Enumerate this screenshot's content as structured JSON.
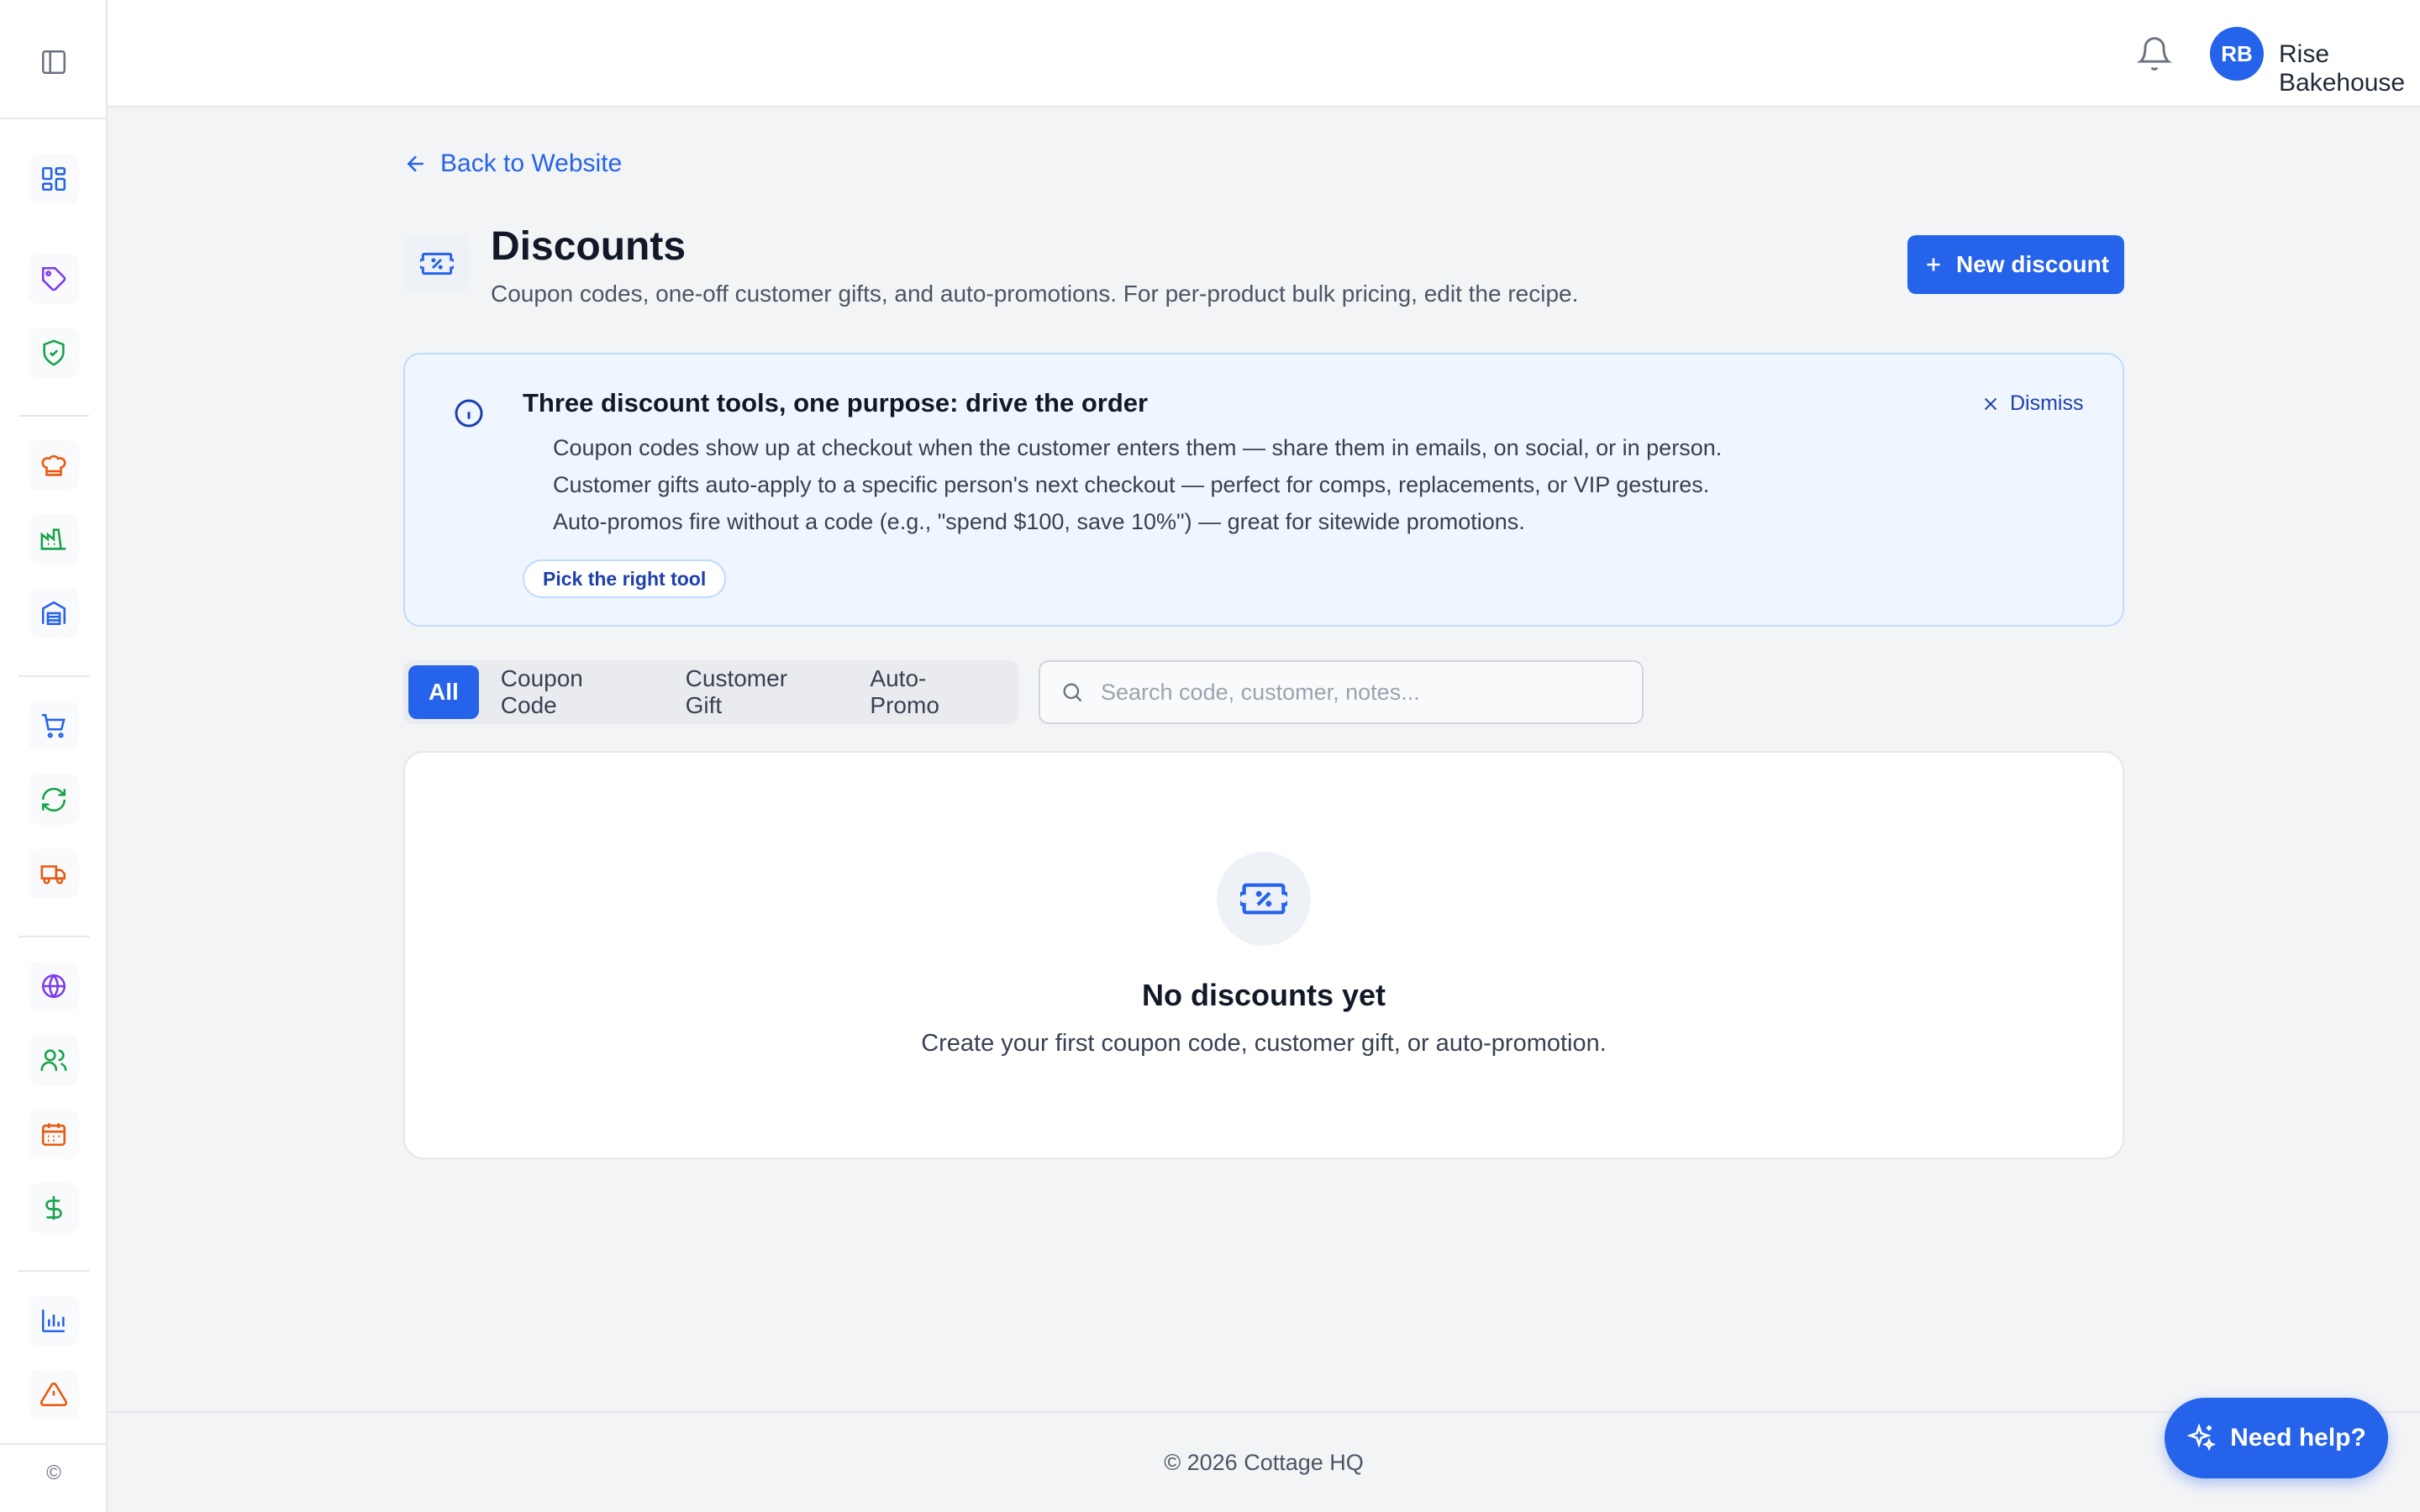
{
  "sidebar": {
    "items": [
      {
        "name": "sidebar-item-dashboard",
        "icon": "dashboard-grid-icon",
        "color": "#2563eb"
      },
      {
        "name": "sidebar-item-products",
        "icon": "tag-icon",
        "color": "#7c3aed"
      },
      {
        "name": "sidebar-item-compliance",
        "icon": "shield-check-icon",
        "color": "#16a34a"
      },
      {
        "name": "sidebar-item-recipes",
        "icon": "chef-hat-icon",
        "color": "#ea580c"
      },
      {
        "name": "sidebar-item-production",
        "icon": "factory-icon",
        "color": "#16a34a"
      },
      {
        "name": "sidebar-item-inventory",
        "icon": "warehouse-icon",
        "color": "#2563eb"
      },
      {
        "name": "sidebar-item-orders",
        "icon": "cart-icon",
        "color": "#2563eb"
      },
      {
        "name": "sidebar-item-subscriptions",
        "icon": "refresh-icon",
        "color": "#16a34a"
      },
      {
        "name": "sidebar-item-delivery",
        "icon": "truck-icon",
        "color": "#ea580c"
      },
      {
        "name": "sidebar-item-website",
        "icon": "globe-icon",
        "color": "#7c3aed"
      },
      {
        "name": "sidebar-item-customers",
        "icon": "users-icon",
        "color": "#16a34a"
      },
      {
        "name": "sidebar-item-calendar",
        "icon": "calendar-icon",
        "color": "#ea580c"
      },
      {
        "name": "sidebar-item-finance",
        "icon": "dollar-icon",
        "color": "#16a34a"
      },
      {
        "name": "sidebar-item-reports",
        "icon": "bar-chart-icon",
        "color": "#2563eb"
      },
      {
        "name": "sidebar-item-alerts",
        "icon": "warning-icon",
        "color": "#ea580c"
      }
    ],
    "copyright_symbol": "©"
  },
  "header": {
    "user_initials": "RB",
    "user_name": "Rise Bakehouse",
    "accent": "#2563eb"
  },
  "main": {
    "back_link": "Back to Website",
    "title": "Discounts",
    "subtitle": "Coupon codes, one-off customer gifts, and auto-promotions. For per-product bulk pricing, edit the recipe.",
    "new_button": "New discount"
  },
  "banner": {
    "title": "Three discount tools, one purpose: drive the order",
    "lines": [
      "Coupon codes show up at checkout when the customer enters them — share them in emails, on social, or in person.",
      "Customer gifts auto-apply to a specific person's next checkout — perfect for comps, replacements, or VIP gestures.",
      "Auto-promos fire without a code (e.g., \"spend $100, save 10%\") — great for sitewide promotions."
    ],
    "pick_button": "Pick the right tool",
    "dismiss": "Dismiss"
  },
  "filters": {
    "tabs": [
      "All",
      "Coupon Code",
      "Customer Gift",
      "Auto-Promo"
    ],
    "active_tab": "All",
    "search_placeholder": "Search code, customer, notes..."
  },
  "empty_state": {
    "title": "No discounts yet",
    "text": "Create your first coupon code, customer gift, or auto-promotion."
  },
  "footer": {
    "text": "© 2026 Cottage HQ"
  },
  "help": {
    "label": "Need help?"
  }
}
